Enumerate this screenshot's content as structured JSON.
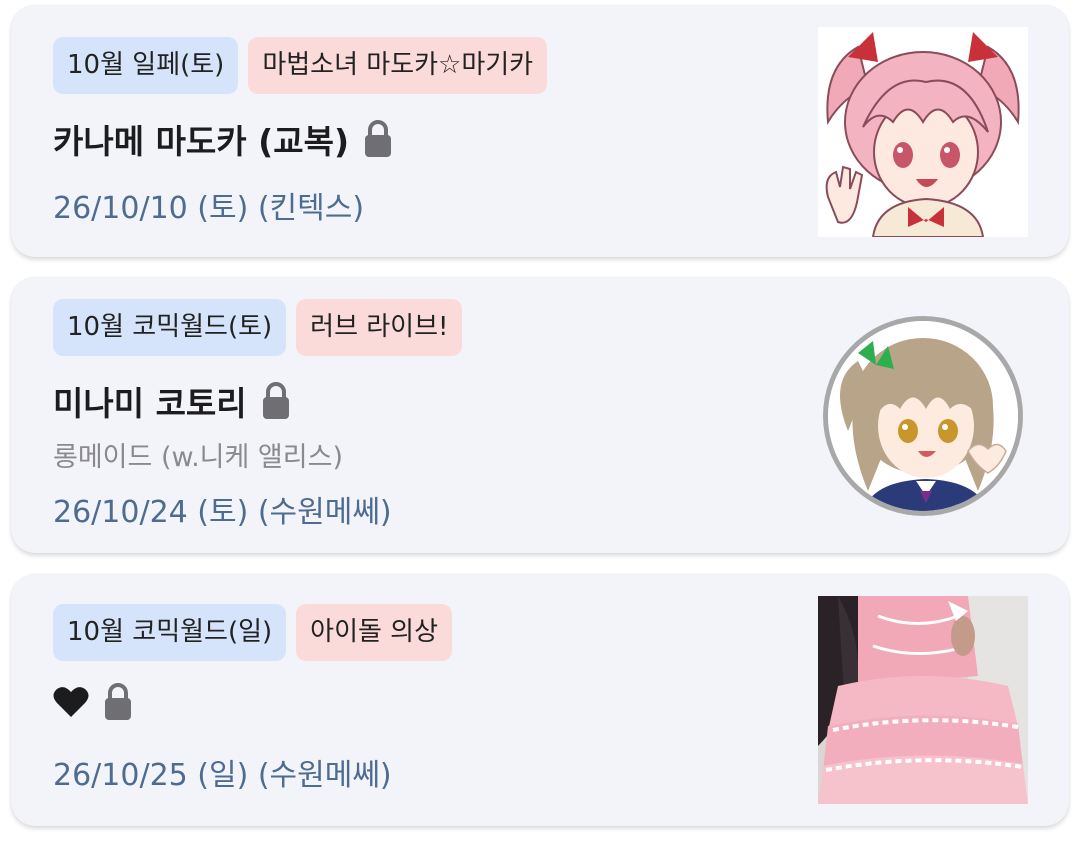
{
  "events": [
    {
      "tags": [
        "10월 일페(토)",
        "마법소녀 마도카☆마기카"
      ],
      "title": "카나메 마도카 (교복)",
      "date": "26/10/10 (토) (킨텍스)",
      "thumbnail": "madoka-character-image"
    },
    {
      "tags": [
        "10월 코믹월드(토)",
        "러브 라이브!"
      ],
      "title": "미나미 코토리",
      "subtitle": "롱메이드 (w.니케 앨리스)",
      "date": "26/10/24 (토) (수원메쎄)",
      "thumbnail": "kotori-character-image"
    },
    {
      "tags": [
        "10월 코믹월드(일)",
        "아이돌 의상"
      ],
      "title_icon": "heart-icon",
      "date": "26/10/25 (일) (수원메쎄)",
      "thumbnail": "pink-dress-photo"
    }
  ],
  "colors": {
    "card_bg": "#f3f4f9",
    "tag_event_bg": "#d6e4fb",
    "tag_series_bg": "#fbdbd9",
    "date_text": "#4e6c8f",
    "subtitle_text": "#8a8a8e"
  }
}
